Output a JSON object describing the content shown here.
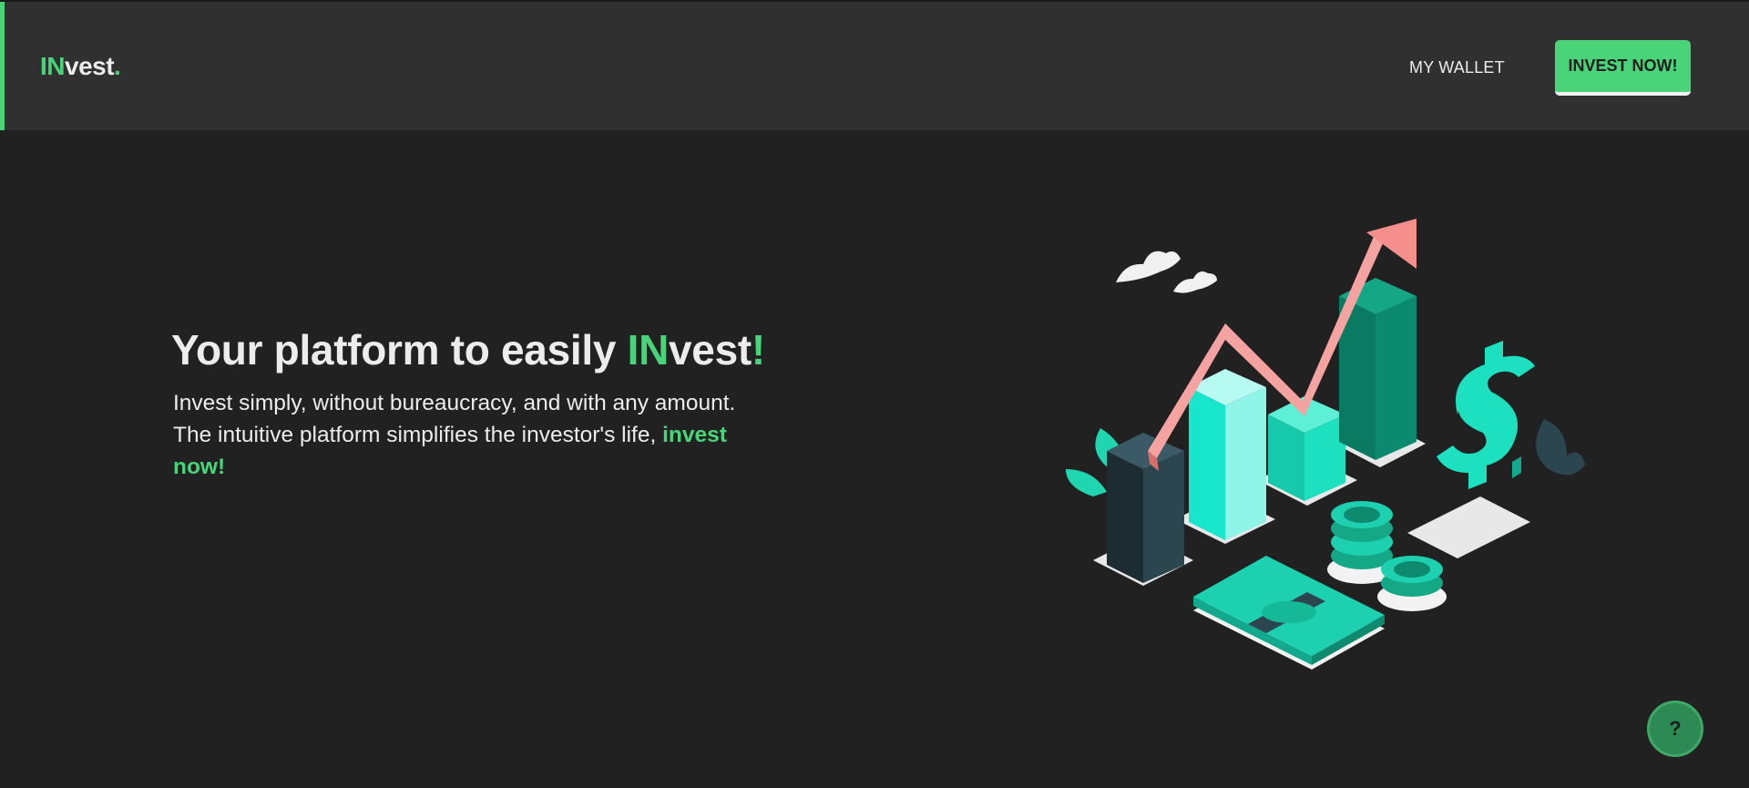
{
  "header": {
    "logo": {
      "prefix": "IN",
      "rest": "vest",
      "dot": "."
    },
    "nav_wallet": "MY WALLET",
    "cta_button": "INVEST NOW!"
  },
  "hero": {
    "title_part1": "Your platform to easily ",
    "title_highlight": "IN",
    "title_part2": "vest",
    "title_exclaim": "!",
    "body": "Invest simply, without bureaucracy, and with any amount. The intuitive platform simplifies the investor's life, ",
    "body_highlight": "invest now!"
  },
  "help_button": {
    "label": "?"
  },
  "colors": {
    "accent": "#4ad47a",
    "background": "#212121",
    "header": "#303030",
    "teal": "#1de9c4",
    "arrow": "#f4a3a0"
  },
  "icons": [
    "growth-chart-illustration",
    "dollar-sign-icon",
    "coin-stack-icon",
    "cash-bundle-icon",
    "cloud-icon",
    "plant-icon"
  ]
}
